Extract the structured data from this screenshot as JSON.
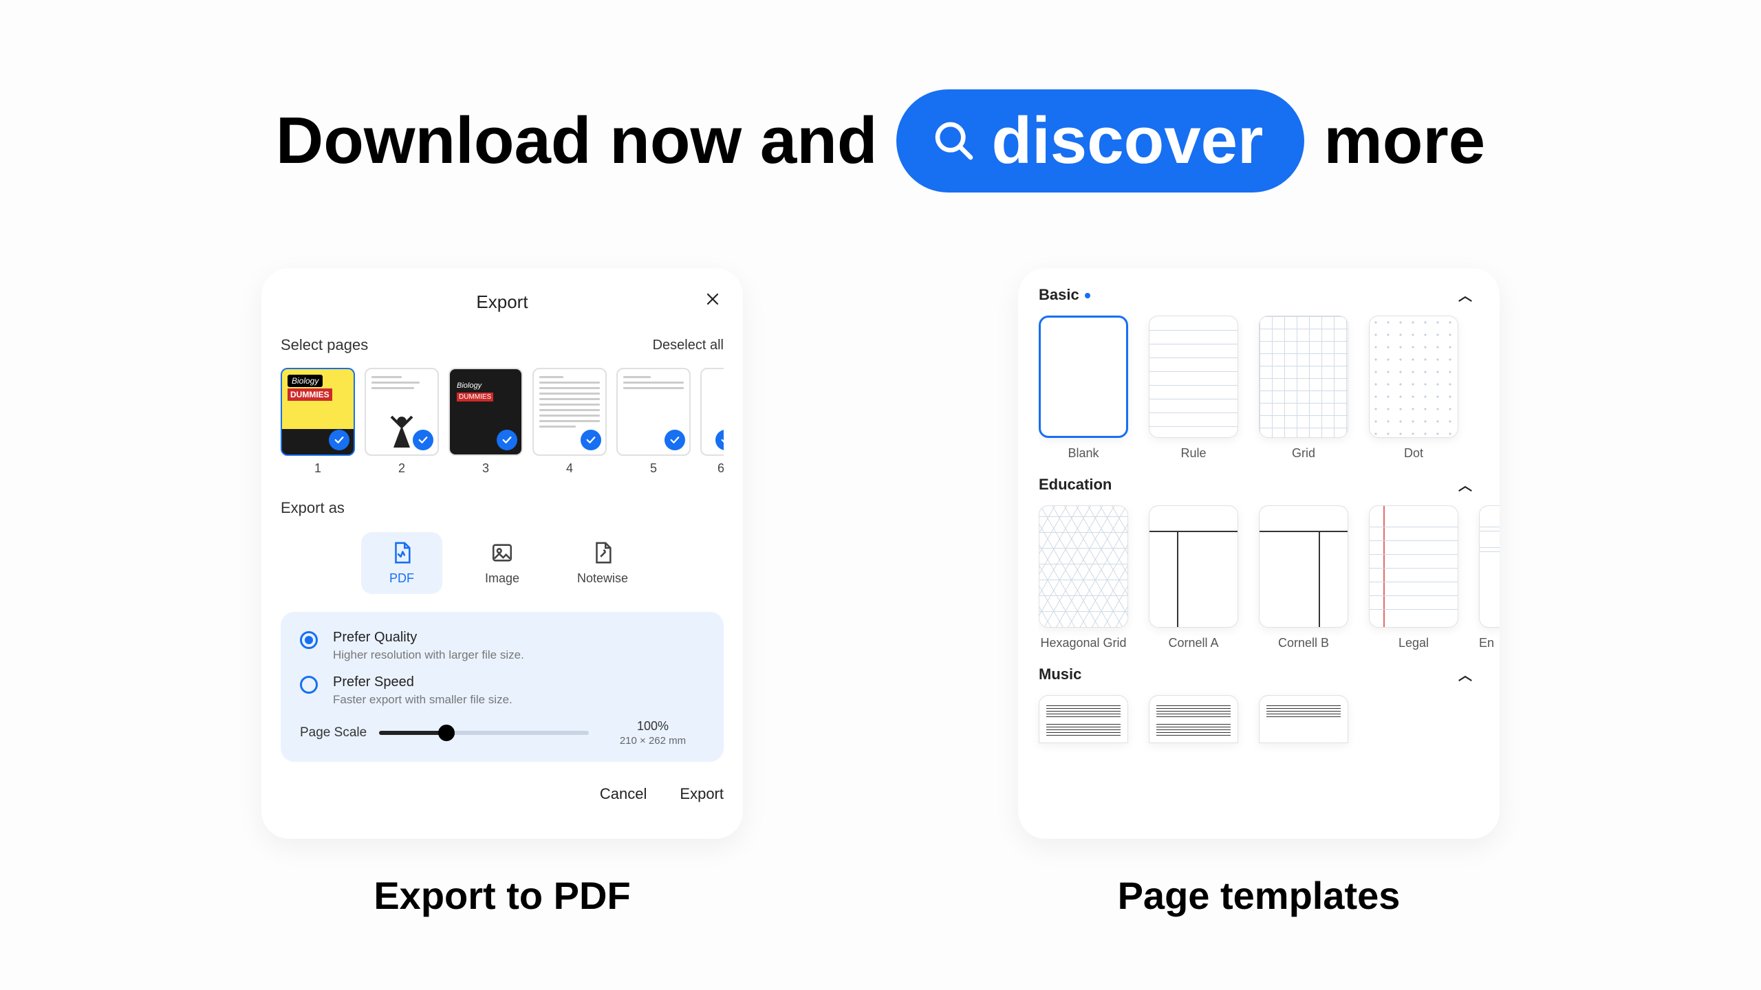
{
  "headline": {
    "pre": "Download now and",
    "pill": "discover",
    "post": "more"
  },
  "captions": {
    "left": "Export to PDF",
    "right": "Page templates"
  },
  "export": {
    "title": "Export",
    "selectPages": "Select pages",
    "deselectAll": "Deselect all",
    "pages": [
      "1",
      "2",
      "3",
      "4",
      "5",
      "6"
    ],
    "exportAs": "Export as",
    "formats": {
      "pdf": "PDF",
      "image": "Image",
      "notewise": "Notewise"
    },
    "quality": {
      "option1_title": "Prefer Quality",
      "option1_sub": "Higher resolution with larger file size.",
      "option2_title": "Prefer Speed",
      "option2_sub": "Faster export with smaller file size."
    },
    "scale": {
      "label": "Page Scale",
      "percent": "100%",
      "dim": "210 × 262 mm"
    },
    "actions": {
      "cancel": "Cancel",
      "export": "Export"
    }
  },
  "templates": {
    "basic": {
      "title": "Basic",
      "items": [
        "Blank",
        "Rule",
        "Grid",
        "Dot"
      ]
    },
    "education": {
      "title": "Education",
      "items": [
        "Hexagonal Grid",
        "Cornell A",
        "Cornell B",
        "Legal",
        "English"
      ]
    },
    "music": {
      "title": "Music"
    }
  }
}
